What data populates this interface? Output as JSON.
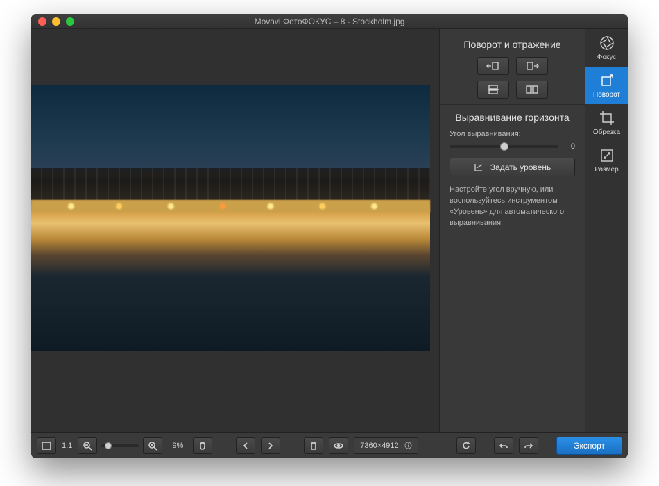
{
  "window": {
    "title": "Movavi ФотоФОКУС – 8 - Stockholm.jpg"
  },
  "panel": {
    "section_rotate": "Поворот и отражение",
    "section_horizon": "Выравнивание горизонта",
    "angle_label": "Угол выравнивания:",
    "angle_value": "0",
    "level_button": "Задать уровень",
    "help": "Настройте угол вручную, или воспользуйтесь инструментом «Уровень» для автоматического выравнивания."
  },
  "tools": {
    "focus": "Фокус",
    "rotate": "Поворот",
    "crop": "Обрезка",
    "resize": "Размер"
  },
  "bottom": {
    "fit": "1:1",
    "zoom_pct": "9%",
    "dimensions": "7360×4912",
    "export": "Экспорт"
  }
}
